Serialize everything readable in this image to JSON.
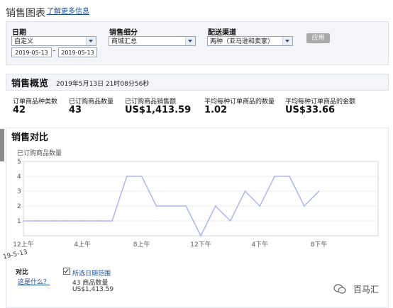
{
  "header": {
    "title": "销售图表",
    "learn_more": "了解更多信息"
  },
  "filters": {
    "date": {
      "label": "日期",
      "select_value": "自定义",
      "start": "2019-05-13",
      "dash": "–",
      "end": "2019-05-13"
    },
    "breakdown": {
      "label": "销售细分",
      "value": "商城汇总"
    },
    "channel": {
      "label": "配送渠道",
      "value": "两种（亚马逊和卖家）"
    },
    "apply": "应用"
  },
  "overview": {
    "title": "销售概览",
    "timestamp": "2019年5月13日 21时08分56秒",
    "metrics": [
      {
        "label": "订单商品种类数",
        "value": "42"
      },
      {
        "label": "已订购商品数量",
        "value": "43"
      },
      {
        "label": "已订购商品销售额",
        "value": "US$1,413.59"
      },
      {
        "label": "平均每种订单商品的数量",
        "value": "1.02"
      },
      {
        "label": "平均每种订单商品的金额",
        "value": "US$33.66"
      }
    ]
  },
  "comparison": {
    "title": "销售对比",
    "date_label": "19-5-13",
    "legend": {
      "label": "对比",
      "help_link": "这是什么？",
      "series_name": "所选日期范围",
      "qty": "43 商品数量",
      "amount": "US$1,413.59",
      "checked": true
    }
  },
  "chart_data": {
    "type": "line",
    "ylabel": "已订购商品数量",
    "ylim": [
      0,
      5
    ],
    "yticks": [
      "1",
      "2",
      "3",
      "4",
      "5"
    ],
    "xticks": [
      "12上午",
      "4上午",
      "8上午",
      "12下午",
      "4下午",
      "8下午"
    ],
    "x_hours": [
      0,
      1,
      2,
      3,
      4,
      5,
      6,
      7,
      8,
      9,
      10,
      11,
      12,
      13,
      14,
      15,
      16,
      17,
      18,
      19,
      20,
      21
    ],
    "series": [
      {
        "values": [
          1,
          1,
          1,
          1,
          1,
          1,
          1,
          4,
          4,
          2,
          2,
          2,
          0,
          2,
          1,
          3,
          2,
          4,
          4,
          2,
          3,
          null
        ],
        "color": "#aab6f2"
      }
    ],
    "grid": true
  },
  "watermark": {
    "text": "百马汇",
    "icon": "wechat-icon"
  }
}
